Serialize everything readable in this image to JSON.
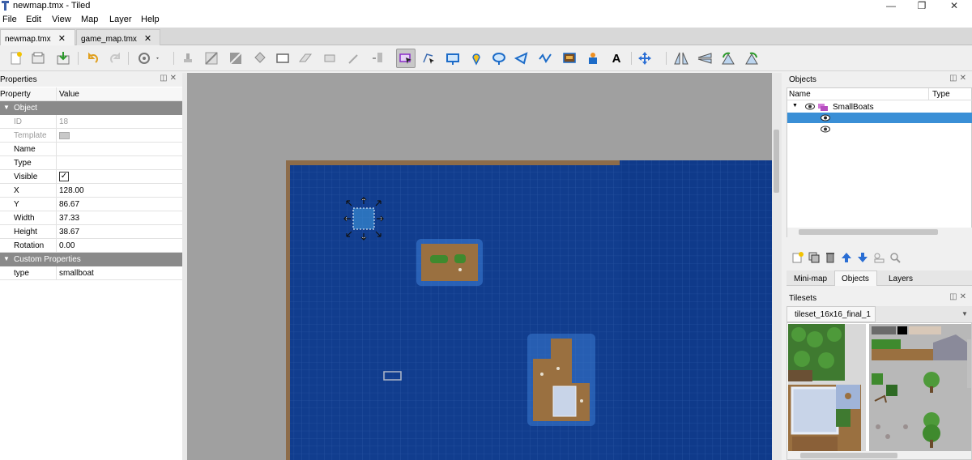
{
  "window": {
    "title": "newmap.tmx - Tiled",
    "minimize": "—",
    "restore": "❐",
    "close": "✕"
  },
  "menu": [
    "File",
    "Edit",
    "View",
    "Map",
    "Layer",
    "Help"
  ],
  "tabs": [
    {
      "label": "newmap.tmx",
      "close": "✕"
    },
    {
      "label": "game_map.tmx",
      "close": "✕"
    }
  ],
  "toolbar": {
    "icons": [
      "new-map-icon",
      "open-icon",
      "save-icon",
      "undo-icon",
      "redo-icon",
      "commands-icon",
      "stamp-brush-icon",
      "terrain-brush-icon",
      "wang-brush-icon",
      "bucket-fill-icon",
      "shape-fill-icon",
      "eraser-icon",
      "rect-select-icon",
      "magic-wand-icon",
      "select-same-tile-icon",
      "select-objects-icon",
      "edit-polygons-icon",
      "insert-rectangle-icon",
      "insert-point-icon",
      "insert-ellipse-icon",
      "insert-polygon-icon",
      "insert-polyline-icon",
      "insert-tile-icon",
      "insert-template-icon",
      "insert-text-icon",
      "move-icon",
      "flip-horizontal-icon",
      "flip-vertical-icon",
      "rotate-left-icon",
      "rotate-right-icon"
    ]
  },
  "properties": {
    "title": "Properties",
    "header": {
      "property": "Property",
      "value": "Value"
    },
    "group_object": "Object",
    "rows": [
      {
        "name": "ID",
        "value": "18",
        "dim": true
      },
      {
        "name": "Template",
        "value": "",
        "dim": true
      },
      {
        "name": "Name",
        "value": ""
      },
      {
        "name": "Type",
        "value": ""
      },
      {
        "name": "Visible",
        "value": "✓"
      },
      {
        "name": "X",
        "value": "128.00"
      },
      {
        "name": "Y",
        "value": "86.67"
      },
      {
        "name": "Width",
        "value": "37.33"
      },
      {
        "name": "Height",
        "value": "38.67"
      },
      {
        "name": "Rotation",
        "value": "0.00"
      }
    ],
    "group_custom": "Custom Properties",
    "custom_rows": [
      {
        "name": "type",
        "value": "smallboat"
      }
    ]
  },
  "objects_panel": {
    "title": "Objects",
    "col_name": "Name",
    "col_type": "Type",
    "layer_name": "SmallBoats",
    "item_count_shown": 2
  },
  "bottom_tabs": [
    "Mini-map",
    "Objects",
    "Layers"
  ],
  "tilesets": {
    "title": "Tilesets",
    "tab": "tileset_16x16_final_1"
  },
  "colors": {
    "water": "#0f3d8c",
    "sand": "#9a7040",
    "selection": "#3a8fd6",
    "grass": "#3f8a2e"
  }
}
